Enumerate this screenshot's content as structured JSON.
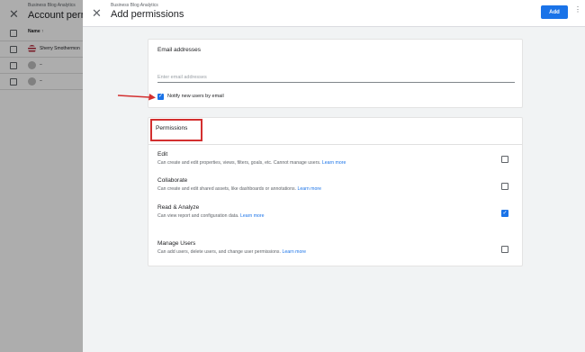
{
  "background": {
    "subtitle": "Business Blog Analytics",
    "title": "Account perm",
    "column_header": "Name ↑",
    "rows": [
      {
        "text": "Sherry Smothermon"
      },
      {
        "text": "–"
      },
      {
        "text": "–"
      }
    ]
  },
  "dialog": {
    "subtitle": "Business Blog Analytics",
    "title": "Add permissions",
    "add_label": "Add",
    "more_label": "⋮",
    "close_label": "✕"
  },
  "email_card": {
    "title": "Email addresses",
    "input_placeholder": "Enter email addresses",
    "notify_label": "Notify new users by email",
    "notify_checked": true
  },
  "permissions_card": {
    "title": "Permissions",
    "items": [
      {
        "name": "Edit",
        "desc": "Can create and edit properties, views, filters, goals, etc. Cannot manage users.",
        "link": "Learn more",
        "checked": false
      },
      {
        "name": "Collaborate",
        "desc": "Can create and edit shared assets, like dashboards or annotations.",
        "link": "Learn more",
        "checked": false
      },
      {
        "name": "Read & Analyze",
        "desc": "Can view report and configuration data.",
        "link": "Learn more",
        "checked": true
      },
      {
        "name": "Manage Users",
        "desc": "Can add users, delete users, and change user permissions.",
        "link": "Learn more",
        "checked": false
      }
    ]
  },
  "colors": {
    "accent": "#1a73e8",
    "annotation_red": "#d32f2f"
  }
}
